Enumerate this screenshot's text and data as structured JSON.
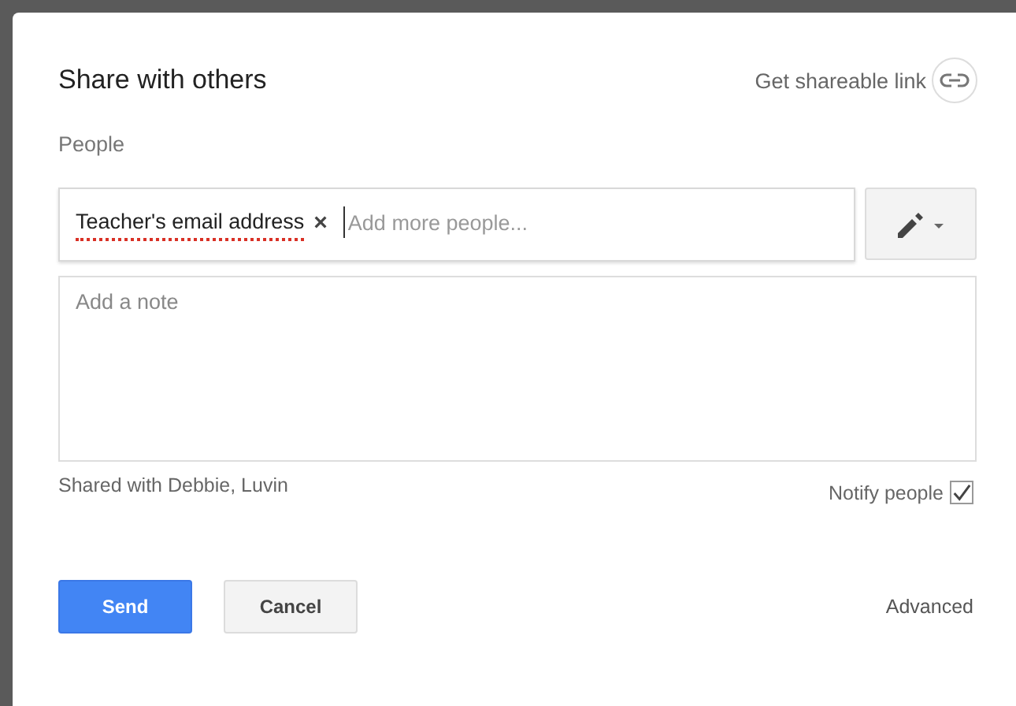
{
  "dialog": {
    "title": "Share with others",
    "shareable_link": "Get shareable link"
  },
  "people": {
    "label": "People",
    "chips": [
      {
        "text": "Teacher's email address",
        "remove": "×",
        "spell_error": true
      }
    ],
    "placeholder": "Add more people..."
  },
  "note": {
    "placeholder": "Add a note"
  },
  "shared_with": "Shared with Debbie, Luvin",
  "notify": {
    "label": "Notify people",
    "checked": true
  },
  "buttons": [
    {
      "label": "Send",
      "kind": "primary"
    },
    {
      "label": "Cancel",
      "kind": "secondary"
    }
  ],
  "advanced": "Advanced"
}
